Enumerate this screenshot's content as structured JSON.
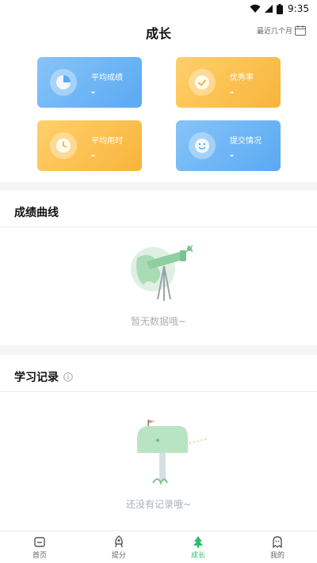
{
  "status_bar": {
    "time": "9:35"
  },
  "header": {
    "title": "成长",
    "action_label": "最近几个月"
  },
  "stat_cards": [
    {
      "label": "平均成绩",
      "value": "-",
      "icon": "pie-chart-icon",
      "color": "#6bb4f5"
    },
    {
      "label": "优秀率",
      "value": "-",
      "icon": "check-circle-icon",
      "color": "#fbbd4c"
    },
    {
      "label": "平均用时",
      "value": "-",
      "icon": "clock-icon",
      "color": "#fbbd4c"
    },
    {
      "label": "提交情况",
      "value": "-",
      "icon": "smile-face-icon",
      "color": "#6bb4f5"
    }
  ],
  "score_curve": {
    "title": "成绩曲线",
    "empty_text": "暂无数据哦~"
  },
  "study_record": {
    "title": "学习记录",
    "empty_text": "还没有记录哦~"
  },
  "tabbar": {
    "items": [
      {
        "label": "首页",
        "icon": "home-icon"
      },
      {
        "label": "提分",
        "icon": "rocket-icon"
      },
      {
        "label": "成长",
        "icon": "tree-icon",
        "active": true
      },
      {
        "label": "我的",
        "icon": "ghost-icon"
      }
    ]
  },
  "accent_color": "#2ebd6b"
}
